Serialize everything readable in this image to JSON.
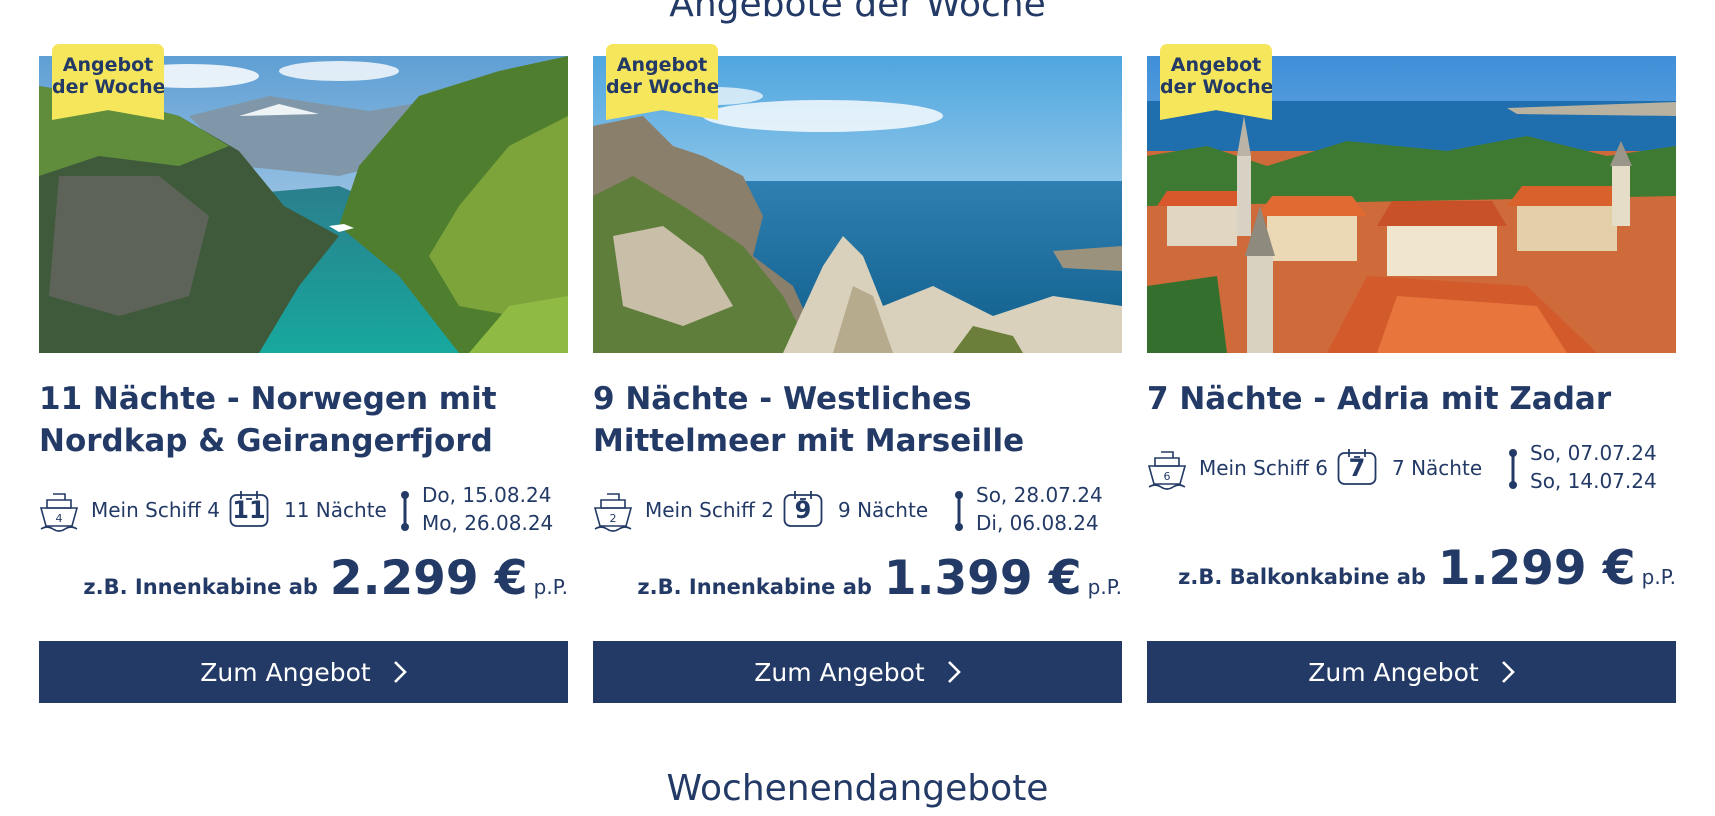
{
  "section_title": "Angebote der Woche",
  "next_section_title": "Wochenendangebote",
  "colors": {
    "primary": "#233a66",
    "badge": "#f6e65b",
    "background": "#ffffff"
  },
  "offers": [
    {
      "badge_line1": "Angebot",
      "badge_line2": "der Woche",
      "image": "norway-fjord-photo",
      "title": "11 Nächte - Norwegen mit Nordkap & Geirangerfjord",
      "ship_icon": "ship-icon",
      "ship_number": "4",
      "ship": "Mein Schiff 4",
      "calendar_icon": "calendar-icon",
      "nights_number": "11",
      "nights": "11 Nächte",
      "date_start": "Do, 15.08.24",
      "date_end": "Mo, 26.08.24",
      "price_prefix": "z.B. Innenkabine ab",
      "price": "2.299 €",
      "price_suffix": "p.P.",
      "cta": "Zum Angebot"
    },
    {
      "badge_line1": "Angebot",
      "badge_line2": "der Woche",
      "image": "mediterranean-coast-photo",
      "title": "9 Nächte - Westliches Mittelmeer mit Marseille",
      "ship_icon": "ship-icon",
      "ship_number": "2",
      "ship": "Mein Schiff 2",
      "calendar_icon": "calendar-icon",
      "nights_number": "9",
      "nights": "9 Nächte",
      "date_start": "So, 28.07.24",
      "date_end": "Di, 06.08.24",
      "price_prefix": "z.B. Innenkabine ab",
      "price": "1.399 €",
      "price_suffix": "p.P.",
      "cta": "Zum Angebot"
    },
    {
      "badge_line1": "Angebot",
      "badge_line2": "der Woche",
      "image": "zadar-old-town-photo",
      "title": "7 Nächte - Adria mit Zadar",
      "ship_icon": "ship-icon",
      "ship_number": "6",
      "ship": "Mein Schiff 6",
      "calendar_icon": "calendar-icon",
      "nights_number": "7",
      "nights": "7 Nächte",
      "date_start": "So, 07.07.24",
      "date_end": "So, 14.07.24",
      "price_prefix": "z.B. Balkonkabine ab",
      "price": "1.299 €",
      "price_suffix": "p.P.",
      "cta": "Zum Angebot"
    }
  ]
}
